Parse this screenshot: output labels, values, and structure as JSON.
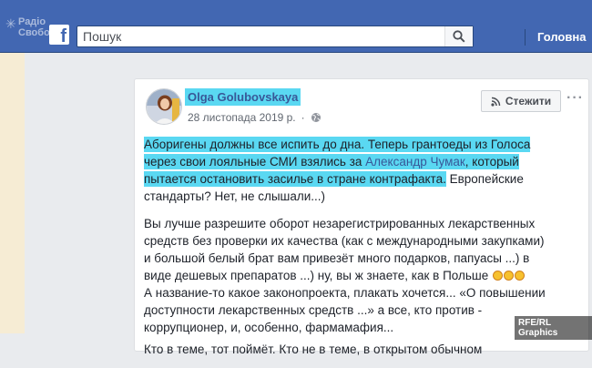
{
  "brand": {
    "line1": "Радіо",
    "line2": "Свобода"
  },
  "header": {
    "search_placeholder": "Пошук",
    "home_label": "Головна"
  },
  "post": {
    "author": "Olga Golubovskaya",
    "date": "28 листопада 2019 р.",
    "follow_label": "Стежити",
    "more_label": "···",
    "highlighted_intro": "Аборигены должны все испить до дна. Теперь грантоеды из Голоса через свои лояльные СМИ взялись за ",
    "mention": "Александр Чумак",
    "highlighted_rest": ", который пытается остановить засилье в стране контрафакта.",
    "p1_tail": " Европейские стандарты? Нет, не слышали...)",
    "p2": "Вы лучше разрешите оборот незарегистрированных лекарственных средств без проверки их качества (как с международными закупками) и большой белый брат вам привезёт много подарков, папуасы ...) в виде дешевых препаратов ...) ну, вы ж знаете, как в Польше",
    "p3": "А название-то какое законопроекта, плакать хочется... «О повышении доступности лекарственных средств ...» а все, кто против - коррупционер, и, особенно, фармамафия...",
    "p4_partial": "Кто в теме, тот поймёт. Кто не в теме, в открытом обычном"
  },
  "credit": "RFE/RL Graphics",
  "colors": {
    "fb_blue": "#4267b2",
    "highlight": "#5ad8f2",
    "link": "#385898"
  },
  "icons": [
    "search-icon",
    "globe-icon",
    "rss-icon",
    "facebook-logo",
    "laughing-emoji"
  ]
}
